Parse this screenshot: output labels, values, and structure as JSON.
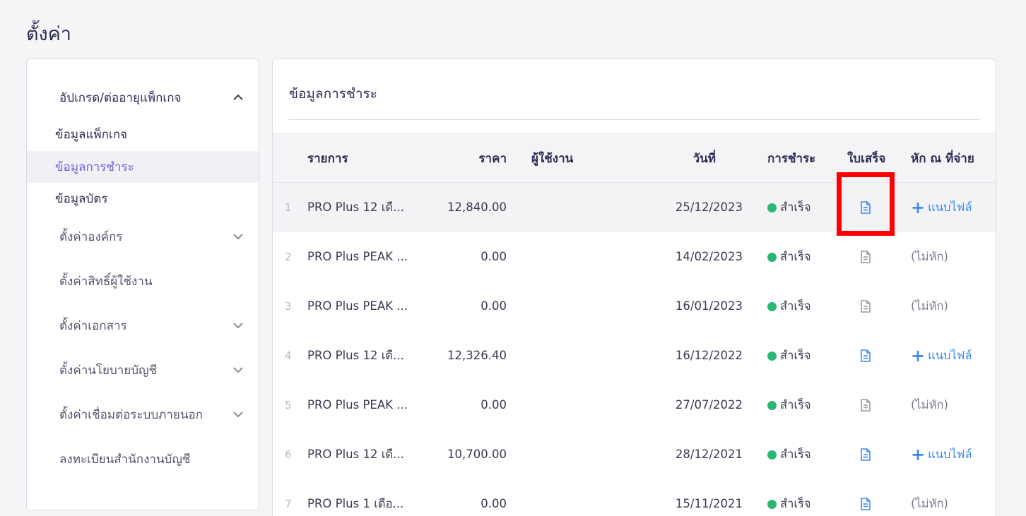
{
  "page_title": "ตั้งค่า",
  "sidebar": {
    "package_group": {
      "label": "อัปเกรด/ต่ออายุแพ็กเกจ"
    },
    "sub_items": [
      {
        "label": "ข้อมูลแพ็กเกจ",
        "active": false
      },
      {
        "label": "ข้อมูลการชำระ",
        "active": true
      },
      {
        "label": "ข้อมูลบัตร",
        "active": false
      }
    ],
    "groups": [
      {
        "label": "ตั้งค่าองค์กร",
        "expandable": true
      },
      {
        "label": "ตั้งค่าสิทธิ์ผู้ใช้งาน",
        "expandable": false
      },
      {
        "label": "ตั้งค่าเอกสาร",
        "expandable": true
      },
      {
        "label": "ตั้งค่านโยบายบัญชี",
        "expandable": true
      },
      {
        "label": "ตั้งค่าเชื่อมต่อระบบภายนอก",
        "expandable": true
      },
      {
        "label": "ลงทะเบียนสำนักงานบัญชี",
        "expandable": false
      }
    ]
  },
  "main": {
    "title": "ข้อมูลการชำระ",
    "columns": {
      "item": "รายการ",
      "price": "ราคา",
      "user": "ผู้ใช้งาน",
      "date": "วันที่",
      "payment": "การชำระ",
      "receipt": "ใบเสร็จ",
      "wht": "หัก ณ ที่จ่าย"
    },
    "rows": [
      {
        "num": "1",
        "item": "PRO Plus 12 เดื...",
        "price": "12,840.00",
        "user": "",
        "date": "25/12/2023",
        "status": "สำเร็จ",
        "receipt_active": true,
        "wht": "แนบไฟล์",
        "wht_type": "attach"
      },
      {
        "num": "2",
        "item": "PRO Plus PEAK ...",
        "price": "0.00",
        "user": "",
        "date": "14/02/2023",
        "status": "สำเร็จ",
        "receipt_active": false,
        "wht": "(ไม่หัก)",
        "wht_type": "none"
      },
      {
        "num": "3",
        "item": "PRO Plus PEAK ...",
        "price": "0.00",
        "user": "",
        "date": "16/01/2023",
        "status": "สำเร็จ",
        "receipt_active": false,
        "wht": "(ไม่หัก)",
        "wht_type": "none"
      },
      {
        "num": "4",
        "item": "PRO Plus 12 เดื...",
        "price": "12,326.40",
        "user": "",
        "date": "16/12/2022",
        "status": "สำเร็จ",
        "receipt_active": true,
        "wht": "แนบไฟล์",
        "wht_type": "attach"
      },
      {
        "num": "5",
        "item": "PRO Plus PEAK ...",
        "price": "0.00",
        "user": "",
        "date": "27/07/2022",
        "status": "สำเร็จ",
        "receipt_active": false,
        "wht": "(ไม่หัก)",
        "wht_type": "none"
      },
      {
        "num": "6",
        "item": "PRO Plus 12 เดื...",
        "price": "10,700.00",
        "user": "",
        "date": "28/12/2021",
        "status": "สำเร็จ",
        "receipt_active": true,
        "wht": "แนบไฟล์",
        "wht_type": "attach"
      },
      {
        "num": "7",
        "item": "PRO Plus 1 เดือ...",
        "price": "0.00",
        "user": "",
        "date": "15/11/2021",
        "status": "สำเร็จ",
        "receipt_active": true,
        "wht": "(ไม่หัก)",
        "wht_type": "none"
      }
    ]
  },
  "colors": {
    "accent": "#6c63d8",
    "link": "#3d8bf2",
    "success": "#2bb673",
    "receipt_inactive": "#9a9aa8",
    "highlight": "#ff0000"
  }
}
